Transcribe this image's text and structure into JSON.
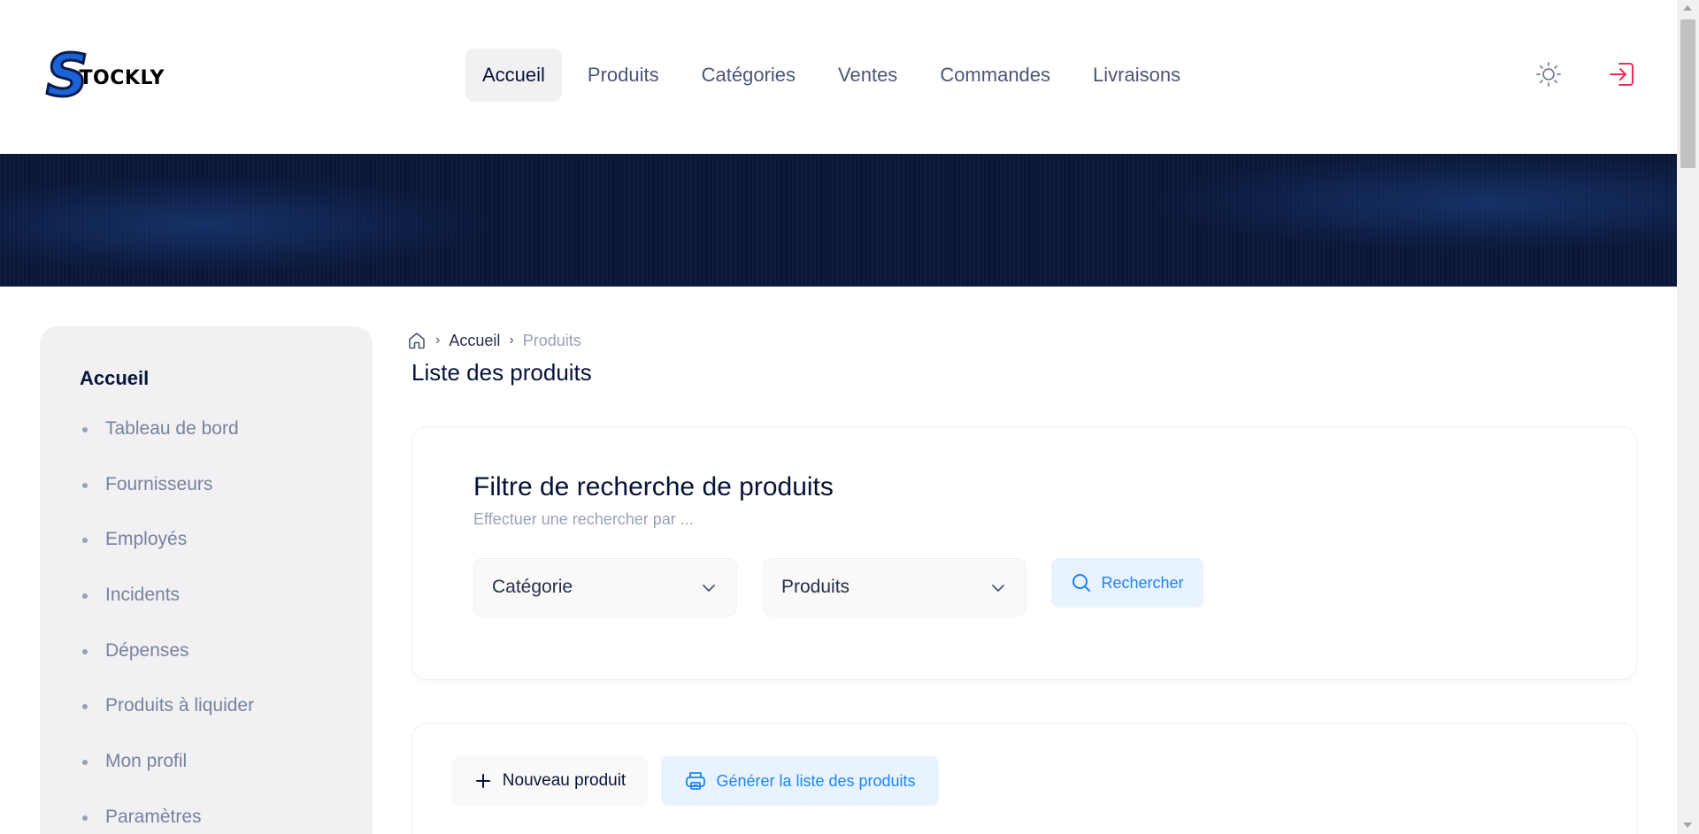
{
  "brand": {
    "logo_letter": "S",
    "logo_rest": "TOCKLY"
  },
  "topnav": {
    "items": [
      {
        "label": "Accueil",
        "active": true
      },
      {
        "label": "Produits"
      },
      {
        "label": "Catégories"
      },
      {
        "label": "Ventes"
      },
      {
        "label": "Commandes"
      },
      {
        "label": "Livraisons"
      }
    ]
  },
  "header_actions": {
    "theme_icon": "sun-icon",
    "logout_icon": "logout-icon",
    "logout_color": "#f8285a"
  },
  "sidebar": {
    "title": "Accueil",
    "items": [
      {
        "label": "Tableau de bord"
      },
      {
        "label": "Fournisseurs"
      },
      {
        "label": "Employés"
      },
      {
        "label": "Incidents"
      },
      {
        "label": "Dépenses"
      },
      {
        "label": "Produits à liquider"
      },
      {
        "label": "Mon profil"
      },
      {
        "label": "Paramètres"
      }
    ]
  },
  "breadcrumb": {
    "home_icon": "home-icon",
    "items": [
      "Accueil",
      "Produits"
    ]
  },
  "page_title": "Liste des produits",
  "filter": {
    "title": "Filtre de recherche de produits",
    "subtitle": "Effectuer une rechercher par ...",
    "category_select": "Catégorie",
    "product_select": "Produits",
    "search_label": "Rechercher"
  },
  "list_actions": {
    "new_label": "Nouveau produit",
    "generate_label": "Générer la liste des produits"
  },
  "colors": {
    "primary": "#1b84ff",
    "primary_light": "#e9f3ff",
    "banner": "#0a1738",
    "danger": "#f8285a"
  }
}
